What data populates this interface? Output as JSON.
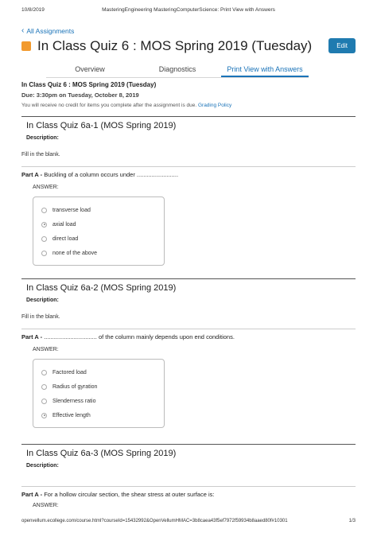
{
  "print_header": {
    "date": "10/8/2019",
    "title": "MasteringEngineering MasteringComputerScience: Print View with Answers"
  },
  "nav": {
    "back_label": "All Assignments"
  },
  "header": {
    "title": "In Class Quiz 6 : MOS Spring 2019 (Tuesday)",
    "edit_label": "Edit",
    "square_color": "#f29a2e",
    "edit_color": "#1f7bb0"
  },
  "tabs": [
    {
      "label": "Overview",
      "active": false
    },
    {
      "label": "Diagnostics",
      "active": false
    },
    {
      "label": "Print View with Answers",
      "active": true
    }
  ],
  "assignment": {
    "title": "In Class Quiz 6 : MOS Spring 2019 (Tuesday)",
    "due": "Due: 3:30pm on Tuesday, October 8, 2019",
    "notice": "You will receive no credit for items you complete after the assignment is due.",
    "grading_link": "Grading Policy"
  },
  "questions": [
    {
      "title": "In Class Quiz 6a-1 (MOS Spring 2019)",
      "description_label": "Description:",
      "fill_text": "Fill in the blank.",
      "part_label": "Part A -",
      "part_text": " Buckling of a column occurs under .........................",
      "answer_label": "ANSWER:",
      "options": [
        {
          "label": "transverse load",
          "selected": false
        },
        {
          "label": "axial load",
          "selected": true
        },
        {
          "label": "direct load",
          "selected": false
        },
        {
          "label": "none of the above",
          "selected": false
        }
      ]
    },
    {
      "title": "In Class Quiz 6a-2 (MOS Spring 2019)",
      "description_label": "Description:",
      "fill_text": "Fill in the blank.",
      "part_label": "Part A -",
      "part_text": " ................................ of the column mainly depends upon end conditions.",
      "answer_label": "ANSWER:",
      "options": [
        {
          "label": "Factored load",
          "selected": false
        },
        {
          "label": "Radius of gyration",
          "selected": false
        },
        {
          "label": "Slenderness ratio",
          "selected": false
        },
        {
          "label": "Effective length",
          "selected": true
        }
      ]
    },
    {
      "title": "In Class Quiz 6a-3 (MOS Spring 2019)",
      "description_label": "Description:",
      "part_label": "Part A -",
      "part_text": " For a hollow circular section, the shear stress at outer surface is:",
      "answer_label": "ANSWER:"
    }
  ],
  "print_footer": {
    "url": "openvellum.ecollege.com/course.html?courseId=15432992&OpenVellumHMAC=3b8caea43f5ef7972f59934b8aaed80f#10301",
    "page": "1/3"
  }
}
